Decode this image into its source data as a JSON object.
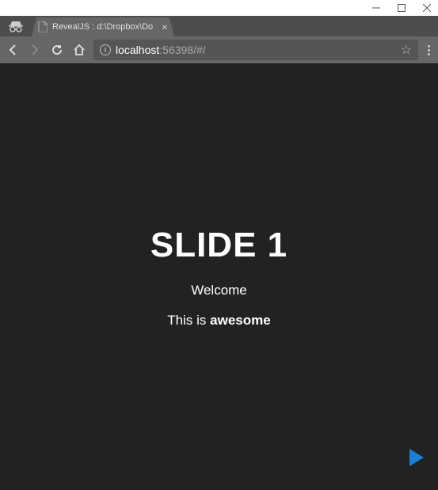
{
  "window": {
    "minimize": "—",
    "maximize": "▢",
    "close": "✕"
  },
  "tab": {
    "title": "RevealJS : d:\\Dropbox\\Do",
    "closeGlyph": "×"
  },
  "nav": {
    "backGlyph": "←",
    "forwardGlyph": "→",
    "reloadGlyph": "⟳",
    "homeGlyph": "⌂"
  },
  "url": {
    "host": "localhost",
    "rest": ":56398/#/",
    "infoGlyph": "i",
    "starGlyph": "☆"
  },
  "slide": {
    "title": "SLIDE 1",
    "subtitle": "Welcome",
    "textPrefix": "This is ",
    "textBold": "awesome"
  }
}
